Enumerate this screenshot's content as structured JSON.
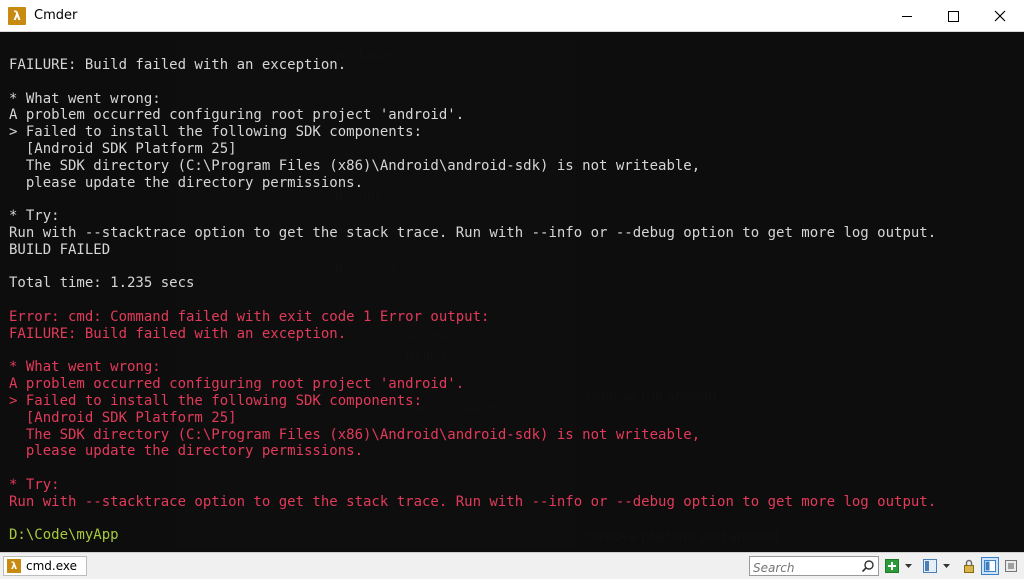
{
  "window": {
    "title": "Cmder",
    "app_icon": "lambda-icon",
    "controls": [
      "minimize-icon",
      "maximize-icon",
      "close-icon"
    ]
  },
  "console": {
    "colors": {
      "default": "#d6d6d6",
      "error": "#e23a5a",
      "prompt": "#a8c93a",
      "background": "#0c0c0c"
    },
    "lines": [
      {
        "text": "FAILURE: Build failed with an exception.",
        "style": "w"
      },
      {
        "text": "",
        "style": "w"
      },
      {
        "text": "* What went wrong:",
        "style": "w"
      },
      {
        "text": "A problem occurred configuring root project 'android'.",
        "style": "w"
      },
      {
        "text": "> Failed to install the following SDK components:",
        "style": "w"
      },
      {
        "text": "  [Android SDK Platform 25]",
        "style": "w"
      },
      {
        "text": "  The SDK directory (C:\\Program Files (x86)\\Android\\android-sdk) is not writeable,",
        "style": "w"
      },
      {
        "text": "  please update the directory permissions.",
        "style": "w"
      },
      {
        "text": "",
        "style": "w"
      },
      {
        "text": "* Try:",
        "style": "w"
      },
      {
        "text": "Run with --stacktrace option to get the stack trace. Run with --info or --debug option to get more log output.",
        "style": "w"
      },
      {
        "text": "BUILD FAILED",
        "style": "w"
      },
      {
        "text": "",
        "style": "w"
      },
      {
        "text": "Total time: 1.235 secs",
        "style": "w"
      },
      {
        "text": "",
        "style": "w"
      },
      {
        "text": "Error: cmd: Command failed with exit code 1 Error output:",
        "style": "r"
      },
      {
        "text": "FAILURE: Build failed with an exception.",
        "style": "r"
      },
      {
        "text": "",
        "style": "r"
      },
      {
        "text": "* What went wrong:",
        "style": "r"
      },
      {
        "text": "A problem occurred configuring root project 'android'.",
        "style": "r"
      },
      {
        "text": "> Failed to install the following SDK components:",
        "style": "r"
      },
      {
        "text": "  [Android SDK Platform 25]",
        "style": "r"
      },
      {
        "text": "  The SDK directory (C:\\Program Files (x86)\\Android\\android-sdk) is not writeable,",
        "style": "r"
      },
      {
        "text": "  please update the directory permissions.",
        "style": "r"
      },
      {
        "text": "",
        "style": "r"
      },
      {
        "text": "* Try:",
        "style": "r"
      },
      {
        "text": "Run with --stacktrace option to get the stack trace. Run with --info or --debug option to get more log output.",
        "style": "r"
      },
      {
        "text": "",
        "style": "w"
      },
      {
        "text": "D:\\Code\\myApp",
        "style": "p"
      }
    ]
  },
  "statusbar": {
    "tab_label": "cmd.exe",
    "search_placeholder": "Search",
    "buttons": [
      "new-console-icon",
      "dropdown-icon",
      "view-icon",
      "dropdown-icon",
      "lock-icon",
      "split-icon",
      "menu-icon"
    ]
  }
}
